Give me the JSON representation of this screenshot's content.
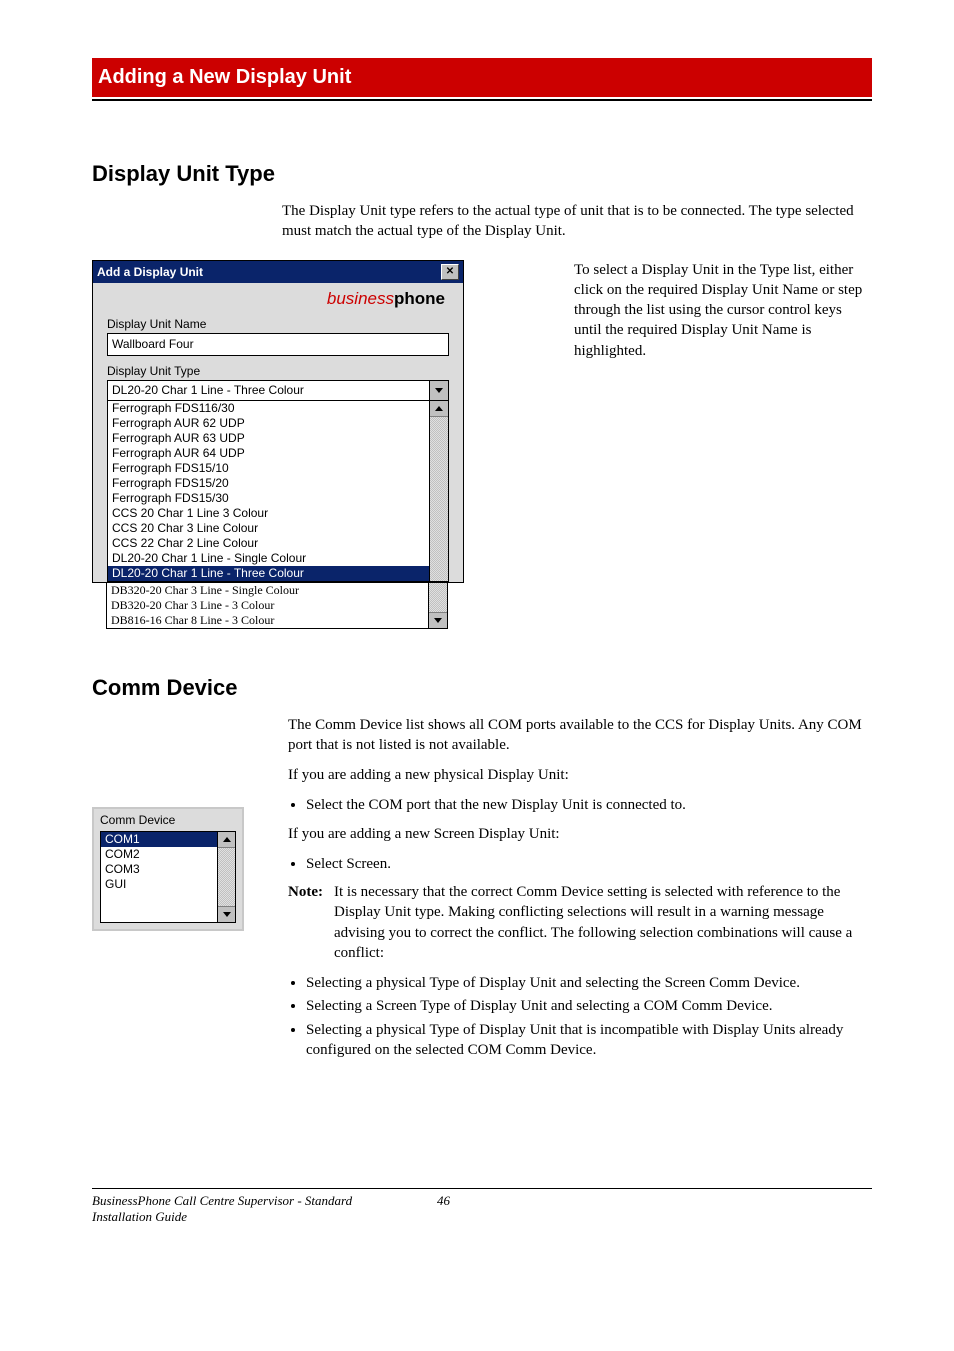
{
  "header": {
    "title": "Adding a New Display Unit"
  },
  "section1": {
    "heading": "Display Unit Type",
    "intro": "The Display Unit type refers to the actual type of unit that is to be connected. The type selected must match the actual type of the Display Unit.",
    "side": "To select a Display Unit in the Type list, either click on the required Display Unit Name or step through the list using the cursor control keys until the required Display Unit Name is highlighted."
  },
  "dialog": {
    "title": "Add a Display Unit",
    "brand_italic": "business",
    "brand_bold": "phone",
    "name_label": "Display Unit Name",
    "name_value": "Wallboard Four",
    "type_label": "Display Unit Type",
    "type_selected": "DL20-20 Char 1 Line - Three Colour",
    "list": [
      "Ferrograph FDS116/30",
      "Ferrograph AUR 62 UDP",
      "Ferrograph AUR 63 UDP",
      "Ferrograph AUR 64 UDP",
      "Ferrograph FDS15/10",
      "Ferrograph FDS15/20",
      "Ferrograph FDS15/30",
      "CCS 20 Char 1 Line 3 Colour",
      "CCS 20 Char 3 Line Colour",
      "CCS 22 Char 2 Line Colour",
      "DL20-20 Char 1 Line - Single Colour",
      "DL20-20 Char 1 Line - Three Colour"
    ],
    "overflow": [
      "DB320-20 Char 3 Line - Single Colour",
      "DB320-20 Char 3 Line - 3 Colour",
      "DB816-16 Char 8 Line - 3 Colour"
    ]
  },
  "section2": {
    "heading": "Comm Device",
    "p1": "The Comm Device list shows all COM ports available to the CCS for Display Units. Any COM port that is not listed is not available.",
    "p2": "If you are adding a new physical Display Unit:",
    "b1": "Select the COM port that the new Display Unit is connected to.",
    "p3": "If you are adding a new Screen Display Unit:",
    "b2": "Select Screen.",
    "note_label": "Note:",
    "note": "It is necessary that the correct Comm Device setting is selected with reference to the Display Unit type. Making conflicting selections will result in a warning message advising you to correct the conflict. The following selection combinations will cause a conflict:",
    "conflicts": [
      "Selecting a physical Type of Display Unit and selecting the Screen Comm Device.",
      "Selecting a Screen Type of Display Unit and selecting a COM Comm Device.",
      "Selecting a physical Type of Display Unit that is incompatible with Display Units already configured on the selected COM Comm Device."
    ]
  },
  "comm_panel": {
    "label": "Comm Device",
    "items": [
      "COM1",
      "COM2",
      "COM3",
      "GUI"
    ]
  },
  "footer": {
    "line1": "BusinessPhone Call Centre Supervisor - Standard",
    "line2": "Installation Guide",
    "page": "46"
  }
}
